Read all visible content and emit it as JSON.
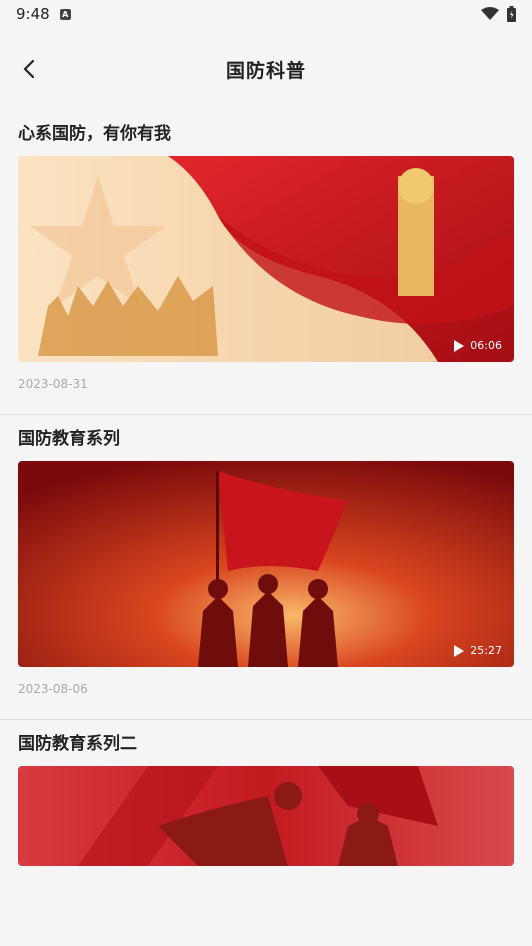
{
  "status_bar": {
    "time": "9:48",
    "notification_label": "A"
  },
  "header": {
    "title": "国防科普"
  },
  "videos": [
    {
      "title": "心系国防，有你有我",
      "duration": "06:06",
      "date": "2023-08-31"
    },
    {
      "title": "国防教育系列",
      "duration": "25:27",
      "date": "2023-08-06"
    },
    {
      "title": "国防教育系列二"
    }
  ],
  "colors": {
    "accent_red": "#c8141c",
    "background": "#f5f5f5"
  }
}
